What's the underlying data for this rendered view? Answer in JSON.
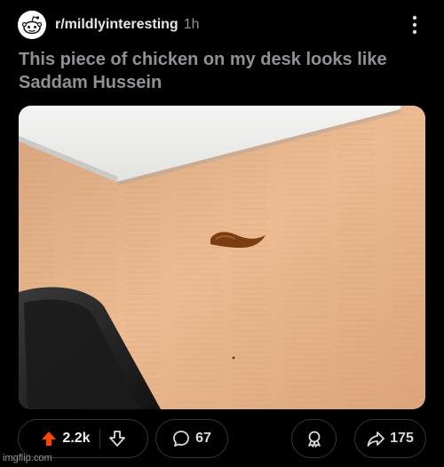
{
  "header": {
    "subreddit": "r/mildlyinteresting",
    "age": "1h",
    "avatar_icon": "reddit-alien-icon",
    "menu_icon": "more-vertical-icon"
  },
  "post": {
    "title": "This piece of chicken on my desk looks like Saddam Hussein",
    "image_subject": "a small piece of chicken on a light wooden desk"
  },
  "actions": {
    "upvote_icon": "upvote-arrow-icon",
    "vote_count": "2.2k",
    "downvote_icon": "downvote-arrow-icon",
    "comment_icon": "comment-bubble-icon",
    "comment_count": "67",
    "award_icon": "award-icon",
    "share_icon": "share-arrow-icon",
    "share_count": "175"
  },
  "watermark": "imgflip.com",
  "colors": {
    "background": "#000000",
    "upvote_accent": "#ff4500",
    "title_text": "#8e9296",
    "pill_border": "#343536"
  }
}
